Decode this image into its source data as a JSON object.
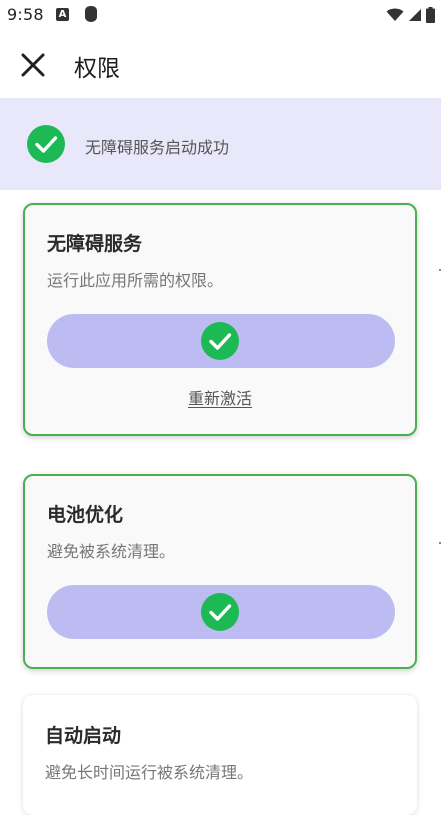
{
  "status_bar": {
    "time": "9:58",
    "notification_letter": "A"
  },
  "app_bar": {
    "title": "权限"
  },
  "banner": {
    "text": "无障碍服务启动成功"
  },
  "cards": [
    {
      "title": "无障碍服务",
      "description": "运行此应用所需的权限。",
      "action_link": "重新激活"
    },
    {
      "title": "电池优化",
      "description": "避免被系统清理。"
    },
    {
      "title": "自动启动",
      "description": "避免长时间运行被系统清理。"
    }
  ],
  "colors": {
    "accent_green": "#1db954",
    "card_border": "#4caf50",
    "pill_fill": "#bcbcf2",
    "banner_bg": "#e9e8fb"
  }
}
